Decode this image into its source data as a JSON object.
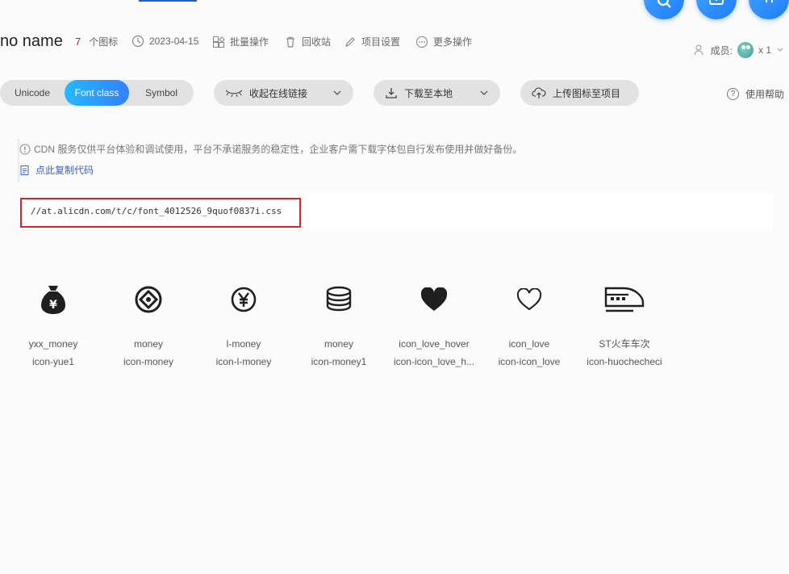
{
  "project": {
    "title": "no name",
    "icon_count": "7",
    "icon_count_suffix": "个图标",
    "date": "2023-04-15"
  },
  "header_actions": {
    "batch": "批量操作",
    "recycle": "回收站",
    "settings": "项目设置",
    "more": "更多操作"
  },
  "members": {
    "label": "成员:",
    "count": "x 1"
  },
  "toolbar": {
    "segments": [
      "Unicode",
      "Font class",
      "Symbol"
    ],
    "active_segment": "Font class",
    "online_link": "收起在线链接",
    "download": "下载至本地",
    "upload": "上传图标至项目",
    "help": "使用帮助"
  },
  "notice": {
    "text": "CDN 服务仅供平台体验和调试使用，平台不承诺服务的稳定性，企业客户需下载字体包自行发布使用并做好备份。",
    "copy": "点此复制代码"
  },
  "code": {
    "url": "//at.alicdn.com/t/c/font_4012526_9quof0837i.css"
  },
  "icons": [
    {
      "name": "yxx_money",
      "class": "icon-yue1",
      "glyph": "money-bag-icon"
    },
    {
      "name": "money",
      "class": "icon-money",
      "glyph": "coin-ring-icon"
    },
    {
      "name": "l-money",
      "class": "icon-l-money",
      "glyph": "yen-circle-icon"
    },
    {
      "name": "money",
      "class": "icon-money1",
      "glyph": "coin-stack-icon"
    },
    {
      "name": "icon_love_hover",
      "class": "icon-icon_love_h...",
      "glyph": "heart-filled-icon"
    },
    {
      "name": "icon_love",
      "class": "icon-icon_love",
      "glyph": "heart-outline-icon"
    },
    {
      "name": "ST火车车次",
      "class": "icon-huochecheci",
      "glyph": "train-icon"
    }
  ],
  "colors": {
    "accent": "#2b8cff",
    "highlight_border": "#d9222a",
    "count_red": "#d31d1d"
  }
}
